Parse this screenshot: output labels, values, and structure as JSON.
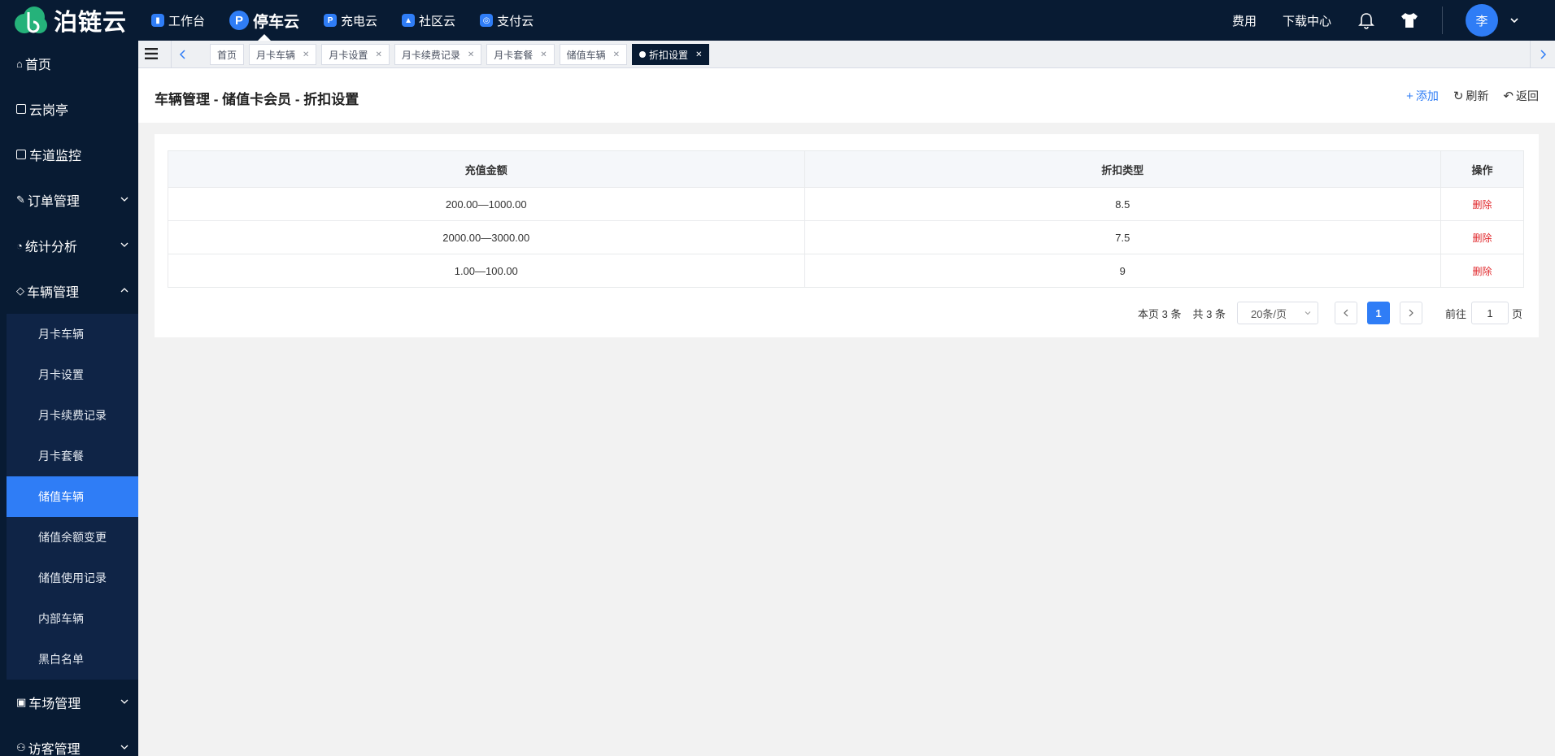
{
  "brand": {
    "name": "泊链云"
  },
  "top_nav": [
    {
      "label": "工作台",
      "icon": "bar-chart-icon",
      "active": false
    },
    {
      "label": "停车云",
      "icon": "parking-icon",
      "active": true
    },
    {
      "label": "充电云",
      "icon": "charging-icon",
      "active": false
    },
    {
      "label": "社区云",
      "icon": "community-icon",
      "active": false
    },
    {
      "label": "支付云",
      "icon": "payment-icon",
      "active": false
    }
  ],
  "top_right": {
    "fee": "费用",
    "download": "下载中心",
    "avatar": "李"
  },
  "sidebar": {
    "items": [
      {
        "label": "首页",
        "icon": "home-icon"
      },
      {
        "label": "云岗亭",
        "icon": "booth-icon"
      },
      {
        "label": "车道监控",
        "icon": "monitor-icon"
      },
      {
        "label": "订单管理",
        "icon": "order-icon"
      },
      {
        "label": "统计分析",
        "icon": "chart-icon"
      },
      {
        "label": "车辆管理",
        "icon": "vehicle-icon"
      }
    ],
    "sub_items": [
      "月卡车辆",
      "月卡设置",
      "月卡续费记录",
      "月卡套餐",
      "储值车辆",
      "储值余额变更",
      "储值使用记录",
      "内部车辆",
      "黑白名单"
    ],
    "active_sub": "储值车辆",
    "bottom_items": [
      {
        "label": "车场管理",
        "icon": "lot-icon"
      },
      {
        "label": "访客管理",
        "icon": "visitor-icon"
      }
    ]
  },
  "tabs": [
    {
      "label": "首页",
      "closable": false
    },
    {
      "label": "月卡车辆",
      "closable": true
    },
    {
      "label": "月卡设置",
      "closable": true
    },
    {
      "label": "月卡续费记录",
      "closable": true
    },
    {
      "label": "月卡套餐",
      "closable": true
    },
    {
      "label": "储值车辆",
      "closable": true
    },
    {
      "label": "折扣设置",
      "closable": true,
      "active": true
    }
  ],
  "page": {
    "title": "车辆管理 - 储值卡会员 - 折扣设置",
    "add": "添加",
    "refresh": "刷新",
    "back": "返回"
  },
  "table": {
    "columns": [
      "充值金额",
      "折扣类型",
      "操作"
    ],
    "rows": [
      {
        "amount": "200.00—1000.00",
        "discount": "8.5",
        "action": "删除"
      },
      {
        "amount": "2000.00—3000.00",
        "discount": "7.5",
        "action": "删除"
      },
      {
        "amount": "1.00—100.00",
        "discount": "9",
        "action": "删除"
      }
    ]
  },
  "pagination": {
    "page_count_text": "本页 3 条",
    "total_text": "共 3 条",
    "page_size": "20条/页",
    "current_page": "1",
    "goto_label": "前往",
    "goto_value": "1",
    "page_unit": "页"
  },
  "colors": {
    "primary": "#2f7df6",
    "nav_bg": "#081b33",
    "danger": "#e0262a"
  }
}
